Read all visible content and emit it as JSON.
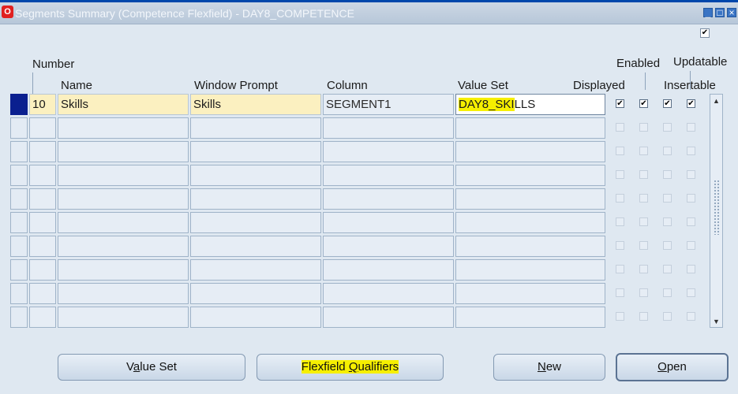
{
  "window": {
    "title": "Segments Summary (Competence Flexfield) - DAY8_COMPETENCE",
    "app_icon": "O",
    "controls": [
      "_",
      "□",
      "×"
    ]
  },
  "top_checkbox_checked": true,
  "headers": {
    "number": "Number",
    "name": "Name",
    "window_prompt": "Window Prompt",
    "column": "Column",
    "value_set": "Value Set",
    "displayed": "Displayed",
    "enabled": "Enabled",
    "updatable": "Updatable",
    "insertable": "Insertable"
  },
  "rows": [
    {
      "number": "10",
      "name": "Skills",
      "window_prompt": "Skills",
      "column": "SEGMENT1",
      "value_set_highlighted": "DAY8_SKI",
      "value_set_rest": "LLS",
      "displayed": true,
      "enabled": true,
      "updatable": true,
      "insertable": true
    }
  ],
  "empty_row_count": 9,
  "buttons": {
    "value_set": {
      "pre": "V",
      "ul": "a",
      "post": "lue Set"
    },
    "flexfield_qualifiers": {
      "pre": "Flexfield ",
      "ul": "Q",
      "post": "ualifiers"
    },
    "new": {
      "pre": "",
      "ul": "N",
      "post": "ew"
    },
    "open": {
      "pre": "",
      "ul": "O",
      "post": "pen"
    }
  },
  "colors": {
    "highlight": "#f6ef00",
    "required_field": "#fbf0c0",
    "current_row": "#0a1f8f"
  }
}
